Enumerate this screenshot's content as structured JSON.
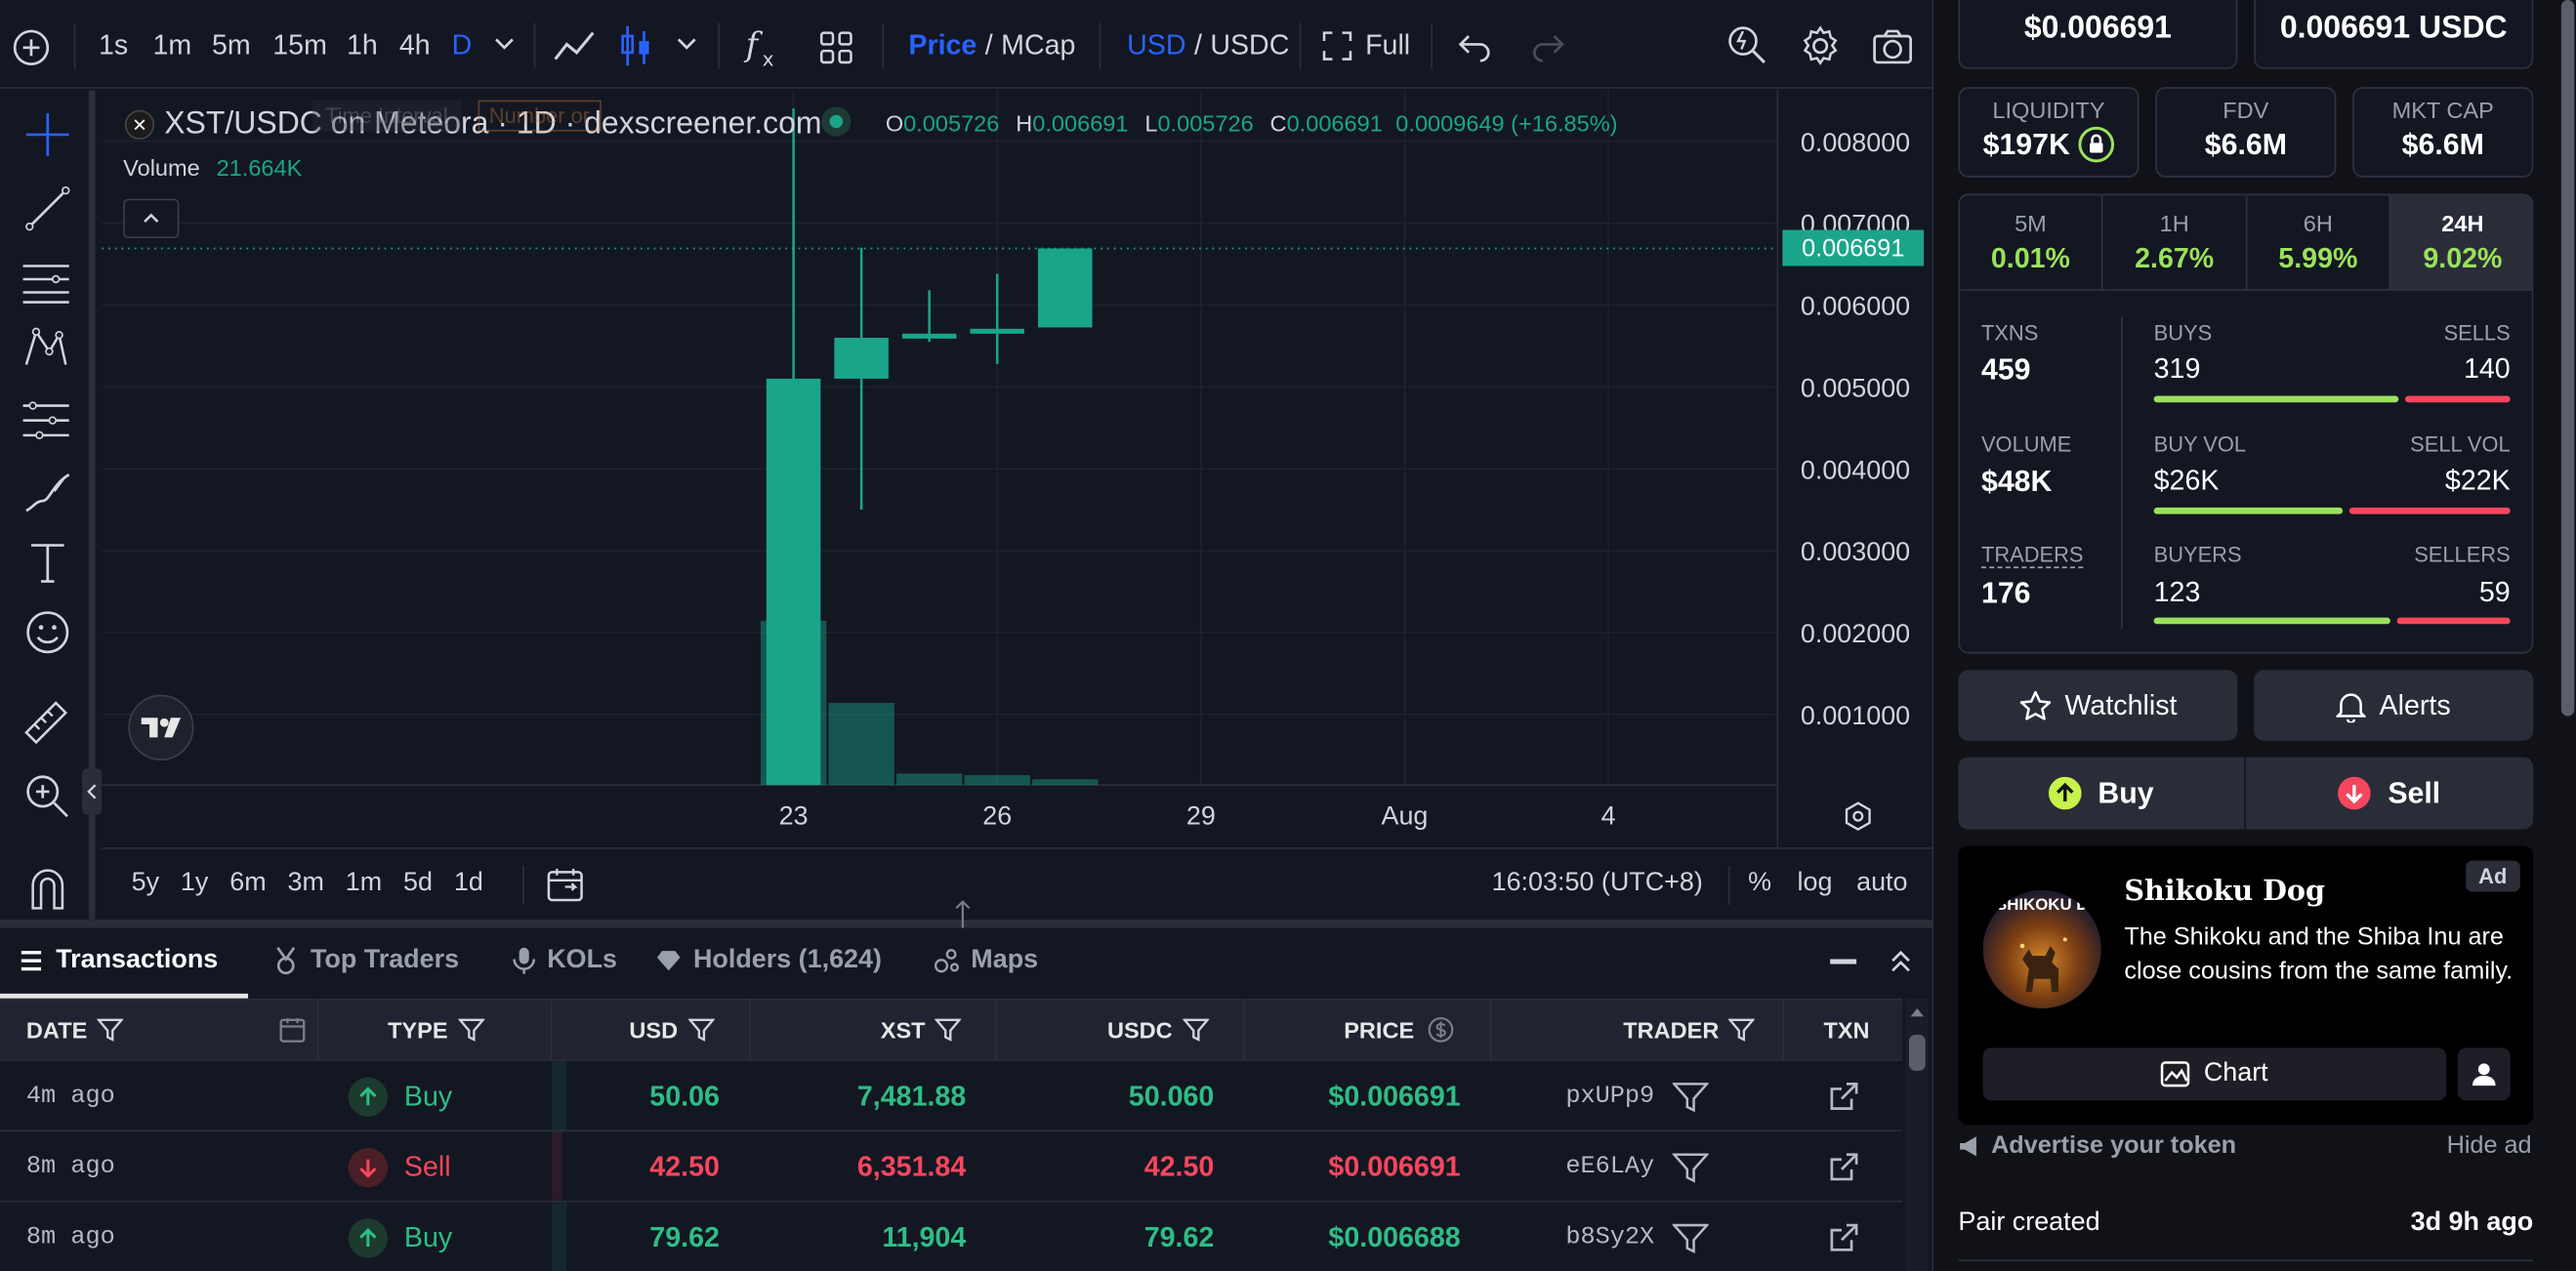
{
  "toolbar": {
    "intervals": [
      "1s",
      "1m",
      "5m",
      "15m",
      "1h",
      "4h",
      "D"
    ],
    "active_interval": "D",
    "price_label": "Price",
    "mcap_label": "MCap",
    "usd_label": "USD",
    "usdc_label": "USDC",
    "full_label": "Full",
    "slash": "/"
  },
  "chart": {
    "symbol": "XST/USDC on Meteora · 1D · dexscreener.com",
    "ohlc": {
      "o_label": "O",
      "o": "0.005726",
      "h_label": "H",
      "h": "0.006691",
      "l_label": "L",
      "l": "0.005726",
      "c_label": "C",
      "c": "0.006691",
      "change": "0.0009649 (+16.85%)"
    },
    "volume_label": "Volume",
    "volume_value": "21.664K",
    "ghost_interval": "Time Interval",
    "ghost_number": "Number or",
    "last_price_tag": "0.006691",
    "time": "16:03:50 (UTC+8)",
    "ranges": [
      "5y",
      "1y",
      "6m",
      "3m",
      "1m",
      "5d",
      "1d"
    ],
    "pct": "%",
    "log": "log",
    "auto": "auto"
  },
  "chart_data": {
    "type": "candlestick",
    "y_ticks": [
      "0.008000",
      "0.007000",
      "0.006000",
      "0.005000",
      "0.004000",
      "0.003000",
      "0.002000",
      "0.001000"
    ],
    "x_ticks": [
      "23",
      "26",
      "29",
      "Aug",
      "4"
    ],
    "candles": [
      {
        "day": 23,
        "o": 0.0,
        "h": 0.0084,
        "l": 0.0,
        "c": 0.0051
      },
      {
        "day": 24,
        "o": 0.0051,
        "h": 0.0067,
        "l": 0.0035,
        "c": 0.0056
      },
      {
        "day": 25,
        "o": 0.00561,
        "h": 0.00618,
        "l": 0.00555,
        "c": 0.00565
      },
      {
        "day": 26,
        "o": 0.00565,
        "h": 0.00638,
        "l": 0.00528,
        "c": 0.00571
      },
      {
        "day": 27,
        "o": 0.005726,
        "h": 0.006691,
        "l": 0.005726,
        "c": 0.006691
      }
    ],
    "volumes": [
      {
        "day": 23,
        "v": 1.0
      },
      {
        "day": 24,
        "v": 0.5
      },
      {
        "day": 25,
        "v": 0.07
      },
      {
        "day": 26,
        "v": 0.06
      },
      {
        "day": 27,
        "v": 0.035
      }
    ],
    "ylim": [
      0.0,
      0.0086
    ]
  },
  "tabs": [
    {
      "label": "Transactions"
    },
    {
      "label": "Top Traders"
    },
    {
      "label": "KOLs"
    },
    {
      "label": "Holders (1,624)"
    },
    {
      "label": "Maps"
    }
  ],
  "table": {
    "headers": [
      "DATE",
      "TYPE",
      "USD",
      "XST",
      "USDC",
      "PRICE",
      "TRADER",
      "TXN"
    ],
    "rows": [
      {
        "date": "4m ago",
        "type": "Buy",
        "usd": "50.06",
        "xst": "7,481.88",
        "usdc": "50.060",
        "price": "$0.006691",
        "trader": "pxUPp9",
        "side": "buy"
      },
      {
        "date": "8m ago",
        "type": "Sell",
        "usd": "42.50",
        "xst": "6,351.84",
        "usdc": "42.50",
        "price": "$0.006691",
        "trader": "eE6LAy",
        "side": "sell"
      },
      {
        "date": "8m ago",
        "type": "Buy",
        "usd": "79.62",
        "xst": "11,904",
        "usdc": "79.62",
        "price": "$0.006688",
        "trader": "b8Sy2X",
        "side": "buy"
      }
    ]
  },
  "panel": {
    "price_usd": "$0.006691",
    "price_native": "0.006691 USDC",
    "liquidity_label": "LIQUIDITY",
    "liquidity": "$197K",
    "fdv_label": "FDV",
    "fdv": "$6.6M",
    "mcap_label": "MKT CAP",
    "mcap": "$6.6M",
    "periods": [
      {
        "label": "5M",
        "value": "0.01%"
      },
      {
        "label": "1H",
        "value": "2.67%"
      },
      {
        "label": "6H",
        "value": "5.99%"
      },
      {
        "label": "24H",
        "value": "9.02%"
      }
    ],
    "txns_label": "TXNS",
    "txns": "459",
    "buys_label": "BUYS",
    "buys": "319",
    "sells_label": "SELLS",
    "sells": "140",
    "volume_label": "VOLUME",
    "volume": "$48K",
    "buyvol_label": "BUY VOL",
    "buyvol": "$26K",
    "sellvol_label": "SELL VOL",
    "sellvol": "$22K",
    "traders_label": "TRADERS",
    "traders": "176",
    "buyers_label": "BUYERS",
    "buyers": "123",
    "sellers_label": "SELLERS",
    "sellers": "59",
    "bars": {
      "buys_frac": 0.695,
      "buyvol_frac": 0.54,
      "buyers_frac": 0.675
    },
    "watchlist": "Watchlist",
    "alerts": "Alerts",
    "buy": "Buy",
    "sell": "Sell",
    "ad_badge": "Ad",
    "ad_title": "Shikoku Dog",
    "ad_text": "The Shikoku and the Shiba Inu are close cousins from the same family.",
    "ad_logo_text": "SHIKOKU D",
    "ad_chart": "Chart",
    "advertise": "Advertise your token",
    "hide_ad": "Hide ad",
    "pair_created_label": "Pair created",
    "pair_created": "3d 9h ago"
  },
  "colors": {
    "up": "#1aa58a",
    "buy": "#2ebd85",
    "sell": "#f6465d",
    "accent": "#2962ff"
  }
}
